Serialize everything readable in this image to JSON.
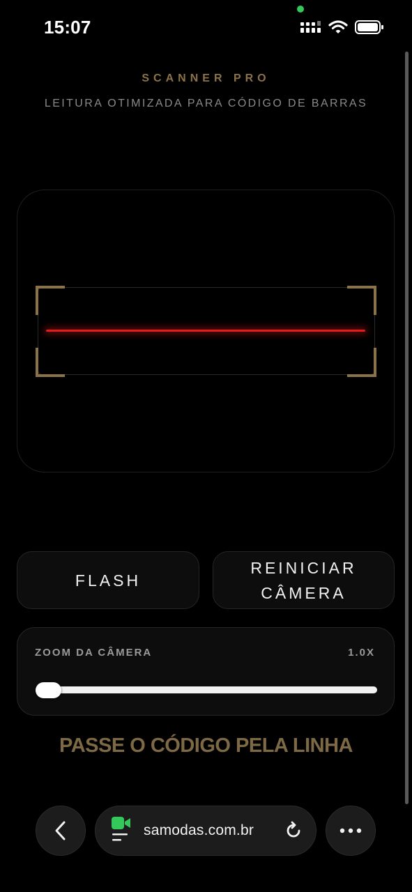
{
  "status_bar": {
    "time": "15:07",
    "icons": [
      "camera-active-dot",
      "signal-icon",
      "wifi-icon",
      "battery-icon"
    ]
  },
  "header": {
    "title": "SCANNER PRO",
    "subtitle": "LEITURA OTIMIZADA PARA CÓDIGO DE BARRAS"
  },
  "scanner": {
    "accent_color": "#8b7349",
    "laser_color": "#e21b1b"
  },
  "buttons": {
    "flash_label": "FLASH",
    "restart_label": "REINICIAR\nCÂMERA"
  },
  "zoom": {
    "label": "ZOOM DA CÂMERA",
    "value_label": "1.0X",
    "value": 1.0,
    "min": 1.0
  },
  "instruction": "PASSE O CÓDIGO PELA LINHA",
  "browser": {
    "url": "samodas.com.br",
    "icons": [
      "back-arrow-icon",
      "facetime-icon",
      "page-menu-icon",
      "reload-icon",
      "more-icon"
    ]
  }
}
